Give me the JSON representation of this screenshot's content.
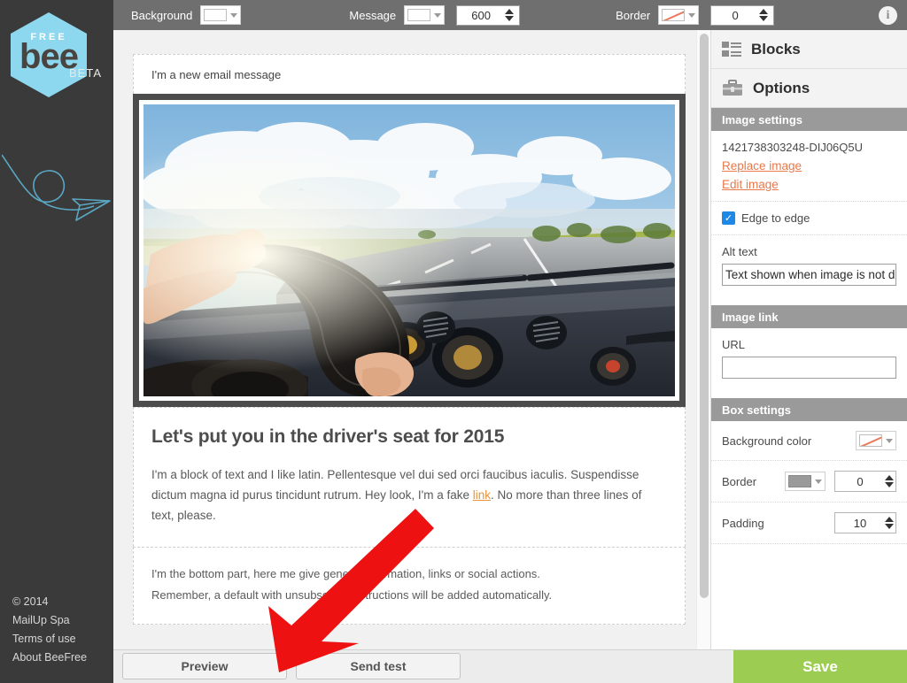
{
  "brand": {
    "logo_free": "FREE",
    "logo_bee": "bee",
    "badge": "BETA",
    "swoosh_icon": "paper-plane-swoosh-icon"
  },
  "left_footer": {
    "copyright": "© 2014",
    "company": "MailUp Spa",
    "terms": "Terms of use",
    "about": "About BeeFree"
  },
  "toolbar": {
    "background_label": "Background",
    "background_color": "#ffffff",
    "message_label": "Message",
    "message_color": "#ffffff",
    "message_width": "600",
    "border_label": "Border",
    "border_color": "none",
    "border_width": "0",
    "info_icon": "info-icon",
    "info_glyph": "i",
    "background_swatch_icon": "color-swatch-icon",
    "caret_icon": "chevron-down-icon"
  },
  "email": {
    "top_text": "I'm a new email message",
    "headline": "Let's put you in the driver's seat for 2015",
    "body_part1": "I'm a block of text and I like latin. Pellentesque vel dui sed orci faucibus iaculis. Suspendisse dictum magna id purus tincidunt rutrum. Hey look, I'm a fake ",
    "body_link": "link",
    "body_part2": ". No more than three lines of text, please.",
    "footer_line1": "I'm the bottom part, here me give general information, links or social actions.",
    "footer_line2": "Remember, a default with unsubscribe instructions will be added automatically.",
    "image_alt": "driving-photo-hands-on-steering-wheel-road"
  },
  "panel": {
    "blocks_tab": "Blocks",
    "blocks_icon": "blocks-grid-icon",
    "options_tab": "Options",
    "options_icon": "toolbox-icon",
    "image_settings_header": "Image settings",
    "image_name": "1421738303248-DIJ06Q5U",
    "replace_image": "Replace image",
    "edit_image": "Edit image",
    "edge_to_edge": "Edge to edge",
    "edge_to_edge_checked": true,
    "check_icon": "checkmark-icon",
    "alt_text_label": "Alt text",
    "alt_text_value": "Text shown when image is not d",
    "image_link_header": "Image link",
    "url_label": "URL",
    "url_value": "",
    "box_settings_header": "Box settings",
    "background_color_label": "Background color",
    "background_color_value": "none",
    "border_label": "Border",
    "border_color_value": "#9a9a9a",
    "border_width": "0",
    "padding_label": "Padding",
    "padding_value": "10"
  },
  "bottom": {
    "preview": "Preview",
    "send_test": "Send test",
    "save": "Save",
    "save_color": "#9ccc52"
  },
  "annotation": {
    "arrow_icon": "red-arrow-icon",
    "arrow_color": "#ee1111",
    "points_to": "preview-button"
  }
}
